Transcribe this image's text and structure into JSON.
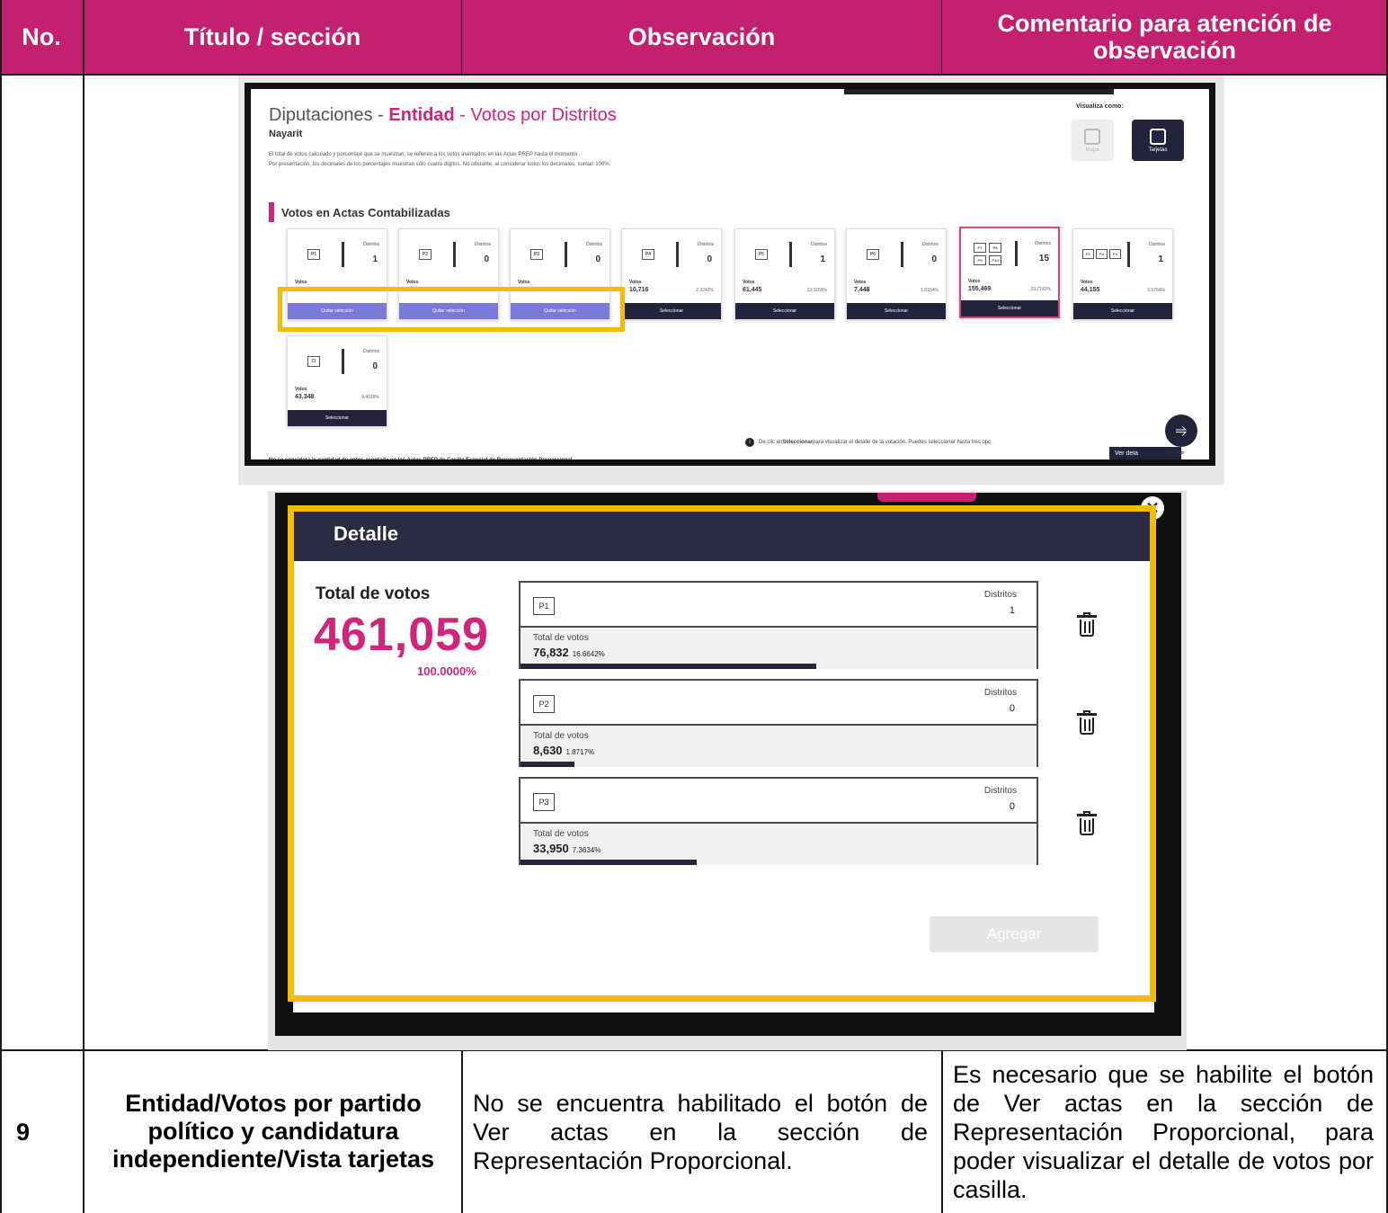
{
  "header": {
    "no": "No.",
    "titulo": "Título / sección",
    "observacion": "Observación",
    "comentario": "Comentario para atención de observación"
  },
  "colors": {
    "header_bg": "#c3216f",
    "highlight": "#f6bb08",
    "accent": "#d0257a",
    "dark": "#23233b"
  },
  "shot1": {
    "title_prefix": "Diputaciones - ",
    "title_entity": "Entidad",
    "title_suffix": " - Votos por Distritos",
    "state": "Nayarit",
    "note_line1": "El total de votos calculado y porcentaje que se muestran, se refieren a los votos asentados en las Actas PREP hasta el momento.",
    "note_line2": "Por presentación, los decimales de los porcentajes muestran sólo cuatro dígitos. No obstante, al considerar todos los decimales, suman 100%.",
    "vis_label": "Visualiza como:",
    "vis_option1": "Mapa",
    "vis_option2": "Tarjetas",
    "section": "Votos en Actas Contabilizadas",
    "distritos_label": "Distritos",
    "votos_label": "Votos",
    "select_label": "Seleccionar",
    "deselect_label": "Quitar selección",
    "cards": [
      {
        "logo": "P1",
        "distritos": "1",
        "votos": "",
        "pct": "",
        "state": "selected"
      },
      {
        "logo": "P2",
        "distritos": "0",
        "votos": "",
        "pct": "",
        "state": "selected"
      },
      {
        "logo": "P3",
        "distritos": "0",
        "votos": "",
        "pct": "",
        "state": "selected"
      },
      {
        "logo": "P4",
        "distritos": "0",
        "votos": "10,716",
        "pct": "2.3242%",
        "state": "normal"
      },
      {
        "logo": "P5",
        "distritos": "1",
        "votos": "61,445",
        "pct": "13.3269%",
        "state": "normal"
      },
      {
        "logo": "P6",
        "distritos": "0",
        "votos": "7,448",
        "pct": "1.6154%",
        "state": "normal"
      },
      {
        "logo": "P7 P8 P9 P10",
        "distritos": "15",
        "votos": "155,469",
        "pct": "33.7243%",
        "state": "highlight"
      },
      {
        "logo": "P1 P2 P4",
        "distritos": "1",
        "votos": "44,155",
        "pct": "9.5764%",
        "state": "normal"
      },
      {
        "logo": "CI",
        "distritos": "0",
        "votos": "43,348",
        "pct": "9.4018%",
        "state": "normal"
      }
    ],
    "info_text_prefix": "De clic en ",
    "info_text_bold": "Seleccionar",
    "info_text_suffix": " para visualizar el detalle de la votación. Puedes seleccionar hasta tres opc",
    "ver_detalle": "Ver deta",
    "share_label": "Compartir",
    "footer": "No se considera la cantidad de votos asentada en las Actas PREP de Casilla Especial de Representación Proporcional."
  },
  "shot2": {
    "modal_title": "Detalle",
    "total_label": "Total de votos",
    "total_value": "461,059",
    "total_pct": "100.0000%",
    "distritos_label": "Distritos",
    "votes_label": "Total de votos",
    "items": [
      {
        "logo": "P1",
        "distritos": "1",
        "votos": "76,832",
        "pct": "16.6642%",
        "fill": 0.5735
      },
      {
        "logo": "P2",
        "distritos": "0",
        "votos": "8,630",
        "pct": "1.8717%",
        "fill": 0.1038
      },
      {
        "logo": "P3",
        "distritos": "0",
        "votos": "33,950",
        "pct": "7.3634%",
        "fill": 0.3408
      }
    ],
    "add_button": "Agregar"
  },
  "row9": {
    "no": "9",
    "titulo": "Entidad/Votos por partido político y candidatura independiente/Vista tarjetas",
    "observacion": "No se encuentra habilitado el botón de Ver actas en la sección de Representación Proporcional.",
    "comentario": "Es necesario que se habilite el botón de Ver actas en la sección de Representación Proporcional, para poder visualizar el detalle de votos por casilla."
  }
}
